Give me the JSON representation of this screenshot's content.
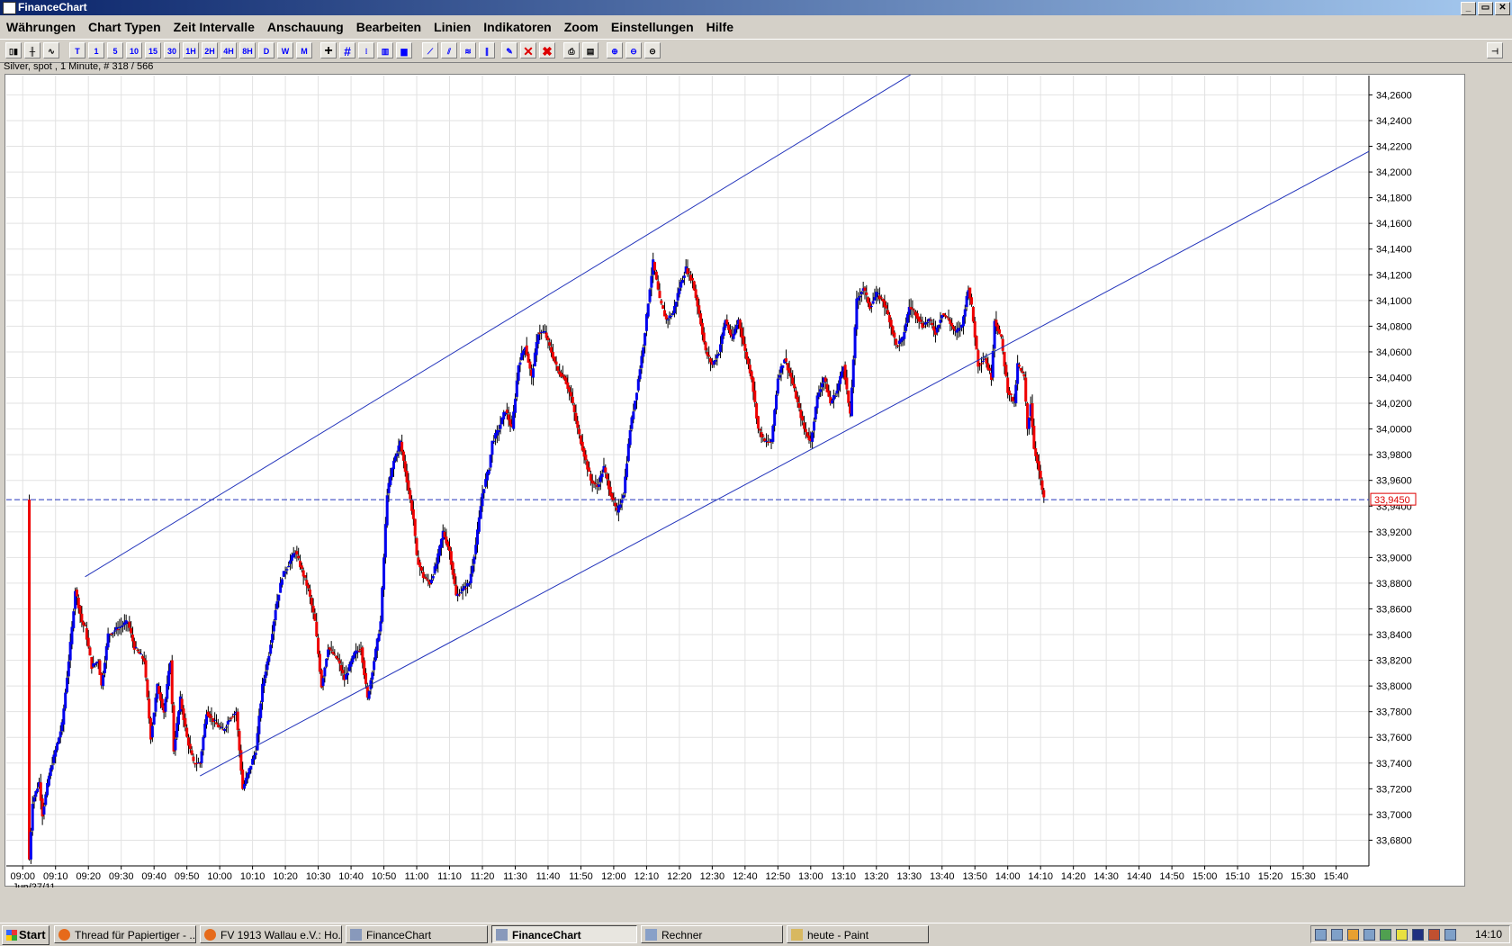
{
  "window": {
    "title": "FinanceChart",
    "buttons": [
      "_",
      "▭",
      "✕"
    ]
  },
  "menu": [
    "Währungen",
    "Chart Typen",
    "Zeit Intervalle",
    "Anschauung",
    "Bearbeiten",
    "Linien",
    "Indikatoren",
    "Zoom",
    "Einstellungen",
    "Hilfe"
  ],
  "toolbar": {
    "intervals": [
      "T",
      "1",
      "5",
      "10",
      "15",
      "30",
      "1H",
      "2H",
      "4H",
      "8H",
      "D",
      "W",
      "M"
    ]
  },
  "info": "Silver, spot , 1 Minute, # 318 / 566",
  "chart_data": {
    "type": "candlestick",
    "instrument": "Silver, spot",
    "interval": "1 Minute",
    "date_label": "Jun/27/11",
    "current_price": "33,9450",
    "ylim": [
      33.66,
      34.275
    ],
    "y_ticks": [
      "34,2600",
      "34,2400",
      "34,2200",
      "34,2000",
      "34,1800",
      "34,1600",
      "34,1400",
      "34,1200",
      "34,1000",
      "34,0800",
      "34,0600",
      "34,0400",
      "34,0200",
      "34,0000",
      "33,9800",
      "33,9600",
      "33,9400",
      "33,9200",
      "33,9000",
      "33,8800",
      "33,8600",
      "33,8400",
      "33,8200",
      "33,8000",
      "33,7800",
      "33,7600",
      "33,7400",
      "33,7200",
      "33,7000",
      "33,6800"
    ],
    "y_tick_values": [
      34.26,
      34.24,
      34.22,
      34.2,
      34.18,
      34.16,
      34.14,
      34.12,
      34.1,
      34.08,
      34.06,
      34.04,
      34.02,
      34.0,
      33.98,
      33.96,
      33.94,
      33.92,
      33.9,
      33.88,
      33.86,
      33.84,
      33.82,
      33.8,
      33.78,
      33.76,
      33.74,
      33.72,
      33.7,
      33.68
    ],
    "x_ticks": [
      "09:00",
      "09:10",
      "09:20",
      "09:30",
      "09:40",
      "09:50",
      "10:00",
      "10:10",
      "10:20",
      "10:30",
      "10:40",
      "10:50",
      "11:00",
      "11:10",
      "11:20",
      "11:30",
      "11:40",
      "11:50",
      "12:00",
      "12:10",
      "12:20",
      "12:30",
      "12:40",
      "12:50",
      "13:00",
      "13:10",
      "13:20",
      "13:30",
      "13:40",
      "13:50",
      "14:00",
      "14:10",
      "14:20",
      "14:30",
      "14:40",
      "14:50",
      "15:00",
      "15:10",
      "15:20",
      "15:30",
      "15:40"
    ],
    "x_tick_minutes": [
      540,
      550,
      560,
      570,
      580,
      590,
      600,
      610,
      620,
      630,
      640,
      650,
      660,
      670,
      680,
      690,
      700,
      710,
      720,
      730,
      740,
      750,
      760,
      770,
      780,
      790,
      800,
      810,
      820,
      830,
      840,
      850,
      860,
      870,
      880,
      890,
      900,
      910,
      920,
      930,
      940
    ],
    "x_range_minutes": [
      535,
      950
    ],
    "trend_lines": [
      {
        "t1": 559,
        "p1": 33.885,
        "t2": 853,
        "p2": 34.342
      },
      {
        "t1": 594,
        "p1": 33.73,
        "t2": 950,
        "p2": 34.216
      }
    ],
    "path": [
      [
        542,
        33.665
      ],
      [
        543,
        33.71
      ],
      [
        545,
        33.725
      ],
      [
        546,
        33.7
      ],
      [
        548,
        33.73
      ],
      [
        550,
        33.75
      ],
      [
        552,
        33.77
      ],
      [
        554,
        33.82
      ],
      [
        555,
        33.845
      ],
      [
        556,
        33.875
      ],
      [
        558,
        33.85
      ],
      [
        559,
        33.845
      ],
      [
        561,
        33.815
      ],
      [
        563,
        33.82
      ],
      [
        564,
        33.8
      ],
      [
        566,
        33.84
      ],
      [
        569,
        33.845
      ],
      [
        572,
        33.85
      ],
      [
        574,
        33.83
      ],
      [
        577,
        33.82
      ],
      [
        579,
        33.76
      ],
      [
        581,
        33.8
      ],
      [
        583,
        33.78
      ],
      [
        585,
        33.82
      ],
      [
        586,
        33.75
      ],
      [
        588,
        33.79
      ],
      [
        590,
        33.76
      ],
      [
        592,
        33.74
      ],
      [
        594,
        33.74
      ],
      [
        596,
        33.78
      ],
      [
        599,
        33.77
      ],
      [
        601,
        33.765
      ],
      [
        603,
        33.775
      ],
      [
        605,
        33.78
      ],
      [
        607,
        33.72
      ],
      [
        609,
        33.735
      ],
      [
        611,
        33.75
      ],
      [
        613,
        33.8
      ],
      [
        615,
        33.825
      ],
      [
        617,
        33.86
      ],
      [
        619,
        33.885
      ],
      [
        621,
        33.895
      ],
      [
        623,
        33.905
      ],
      [
        625,
        33.89
      ],
      [
        627,
        33.875
      ],
      [
        629,
        33.85
      ],
      [
        631,
        33.8
      ],
      [
        633,
        33.83
      ],
      [
        636,
        33.82
      ],
      [
        638,
        33.805
      ],
      [
        641,
        33.825
      ],
      [
        643,
        33.83
      ],
      [
        645,
        33.79
      ],
      [
        647,
        33.82
      ],
      [
        649,
        33.85
      ],
      [
        651,
        33.95
      ],
      [
        653,
        33.975
      ],
      [
        655,
        33.99
      ],
      [
        657,
        33.96
      ],
      [
        659,
        33.93
      ],
      [
        660,
        33.9
      ],
      [
        662,
        33.885
      ],
      [
        664,
        33.88
      ],
      [
        666,
        33.895
      ],
      [
        668,
        33.92
      ],
      [
        670,
        33.905
      ],
      [
        672,
        33.87
      ],
      [
        674,
        33.875
      ],
      [
        676,
        33.88
      ],
      [
        678,
        33.91
      ],
      [
        680,
        33.95
      ],
      [
        682,
        33.97
      ],
      [
        683,
        33.99
      ],
      [
        685,
        34.0
      ],
      [
        687,
        34.015
      ],
      [
        689,
        34.0
      ],
      [
        691,
        34.05
      ],
      [
        693,
        34.065
      ],
      [
        695,
        34.04
      ],
      [
        697,
        34.075
      ],
      [
        699,
        34.075
      ],
      [
        701,
        34.06
      ],
      [
        703,
        34.045
      ],
      [
        705,
        34.04
      ],
      [
        707,
        34.025
      ],
      [
        709,
        34.0
      ],
      [
        711,
        33.98
      ],
      [
        713,
        33.96
      ],
      [
        715,
        33.955
      ],
      [
        717,
        33.97
      ],
      [
        719,
        33.95
      ],
      [
        721,
        33.935
      ],
      [
        723,
        33.95
      ],
      [
        725,
        34.0
      ],
      [
        727,
        34.03
      ],
      [
        729,
        34.065
      ],
      [
        731,
        34.11
      ],
      [
        732,
        34.13
      ],
      [
        734,
        34.1
      ],
      [
        736,
        34.085
      ],
      [
        738,
        34.09
      ],
      [
        740,
        34.11
      ],
      [
        742,
        34.125
      ],
      [
        744,
        34.115
      ],
      [
        746,
        34.09
      ],
      [
        748,
        34.06
      ],
      [
        750,
        34.05
      ],
      [
        752,
        34.06
      ],
      [
        754,
        34.085
      ],
      [
        756,
        34.07
      ],
      [
        758,
        34.085
      ],
      [
        760,
        34.06
      ],
      [
        762,
        34.04
      ],
      [
        764,
        34.0
      ],
      [
        766,
        33.99
      ],
      [
        768,
        33.99
      ],
      [
        770,
        34.04
      ],
      [
        772,
        34.055
      ],
      [
        774,
        34.04
      ],
      [
        776,
        34.02
      ],
      [
        778,
        34.0
      ],
      [
        780,
        33.99
      ],
      [
        782,
        34.025
      ],
      [
        784,
        34.04
      ],
      [
        786,
        34.02
      ],
      [
        788,
        34.03
      ],
      [
        790,
        34.05
      ],
      [
        792,
        34.01
      ],
      [
        794,
        34.1
      ],
      [
        796,
        34.11
      ],
      [
        798,
        34.095
      ],
      [
        800,
        34.105
      ],
      [
        802,
        34.1
      ],
      [
        804,
        34.085
      ],
      [
        806,
        34.065
      ],
      [
        808,
        34.07
      ],
      [
        810,
        34.095
      ],
      [
        812,
        34.09
      ],
      [
        814,
        34.08
      ],
      [
        816,
        34.085
      ],
      [
        818,
        34.075
      ],
      [
        820,
        34.09
      ],
      [
        822,
        34.085
      ],
      [
        824,
        34.075
      ],
      [
        826,
        34.08
      ],
      [
        828,
        34.11
      ],
      [
        829,
        34.095
      ],
      [
        831,
        34.05
      ],
      [
        833,
        34.055
      ],
      [
        835,
        34.04
      ],
      [
        836,
        34.085
      ],
      [
        838,
        34.07
      ],
      [
        840,
        34.03
      ],
      [
        842,
        34.02
      ],
      [
        843,
        34.05
      ],
      [
        845,
        34.04
      ],
      [
        846,
        34.0
      ],
      [
        847,
        34.02
      ],
      [
        848,
        33.985
      ],
      [
        849,
        33.975
      ],
      [
        850,
        33.96
      ],
      [
        851,
        33.945
      ]
    ]
  },
  "taskbar": {
    "start": "Start",
    "tasks": [
      "Thread für Papiertiger - ...",
      "FV 1913 Wallau e.V.: Ho...",
      "FinanceChart",
      "FinanceChart",
      "Rechner",
      "heute - Paint"
    ],
    "clock": "14:10"
  }
}
